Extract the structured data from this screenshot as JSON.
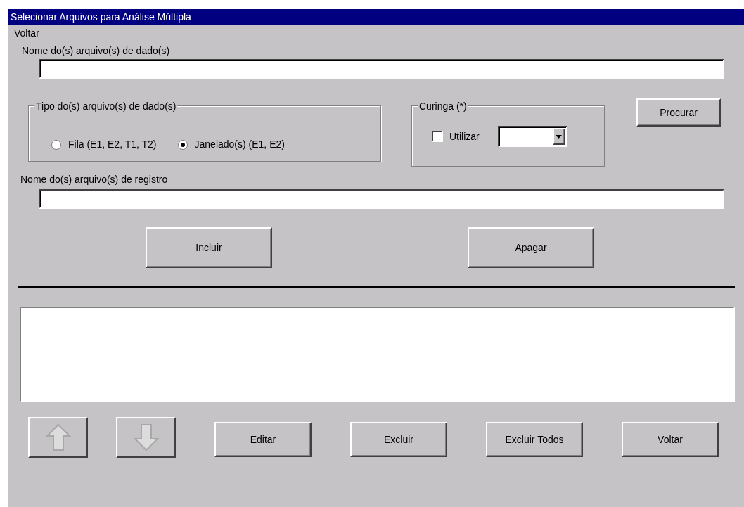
{
  "window": {
    "title": "Selecionar Arquivos para Análise Múltipla"
  },
  "menu": [
    {
      "label": "Voltar"
    }
  ],
  "data_files": {
    "label": "Nome do(s) arquivo(s) de dado(s)"
  },
  "file_type": {
    "title": "Tipo do(s) arquivo(s) de dado(s)",
    "options": [
      {
        "label": "Fila (E1, E2, T1, T2)",
        "selected": false
      },
      {
        "label": "Janelado(s) (E1, E2)",
        "selected": true
      }
    ]
  },
  "wildcard": {
    "title": "Curinga (*)",
    "checkbox": {
      "label": "Utilizar",
      "checked": false
    }
  },
  "browse_button": {
    "label": "Procurar"
  },
  "log_files": {
    "label": "Nome do(s) arquivo(s) de registro"
  },
  "action_buttons": [
    {
      "label": "Incluir"
    },
    {
      "label": "Apagar"
    }
  ],
  "bottom_buttons": [
    {
      "kind": "up",
      "disabled": true
    },
    {
      "kind": "down",
      "disabled": true
    },
    {
      "kind": "text",
      "label": "Editar"
    },
    {
      "kind": "text",
      "label": "Excluir"
    },
    {
      "kind": "text",
      "label": "Excluir Todos"
    },
    {
      "kind": "text",
      "label": "Voltar"
    }
  ]
}
